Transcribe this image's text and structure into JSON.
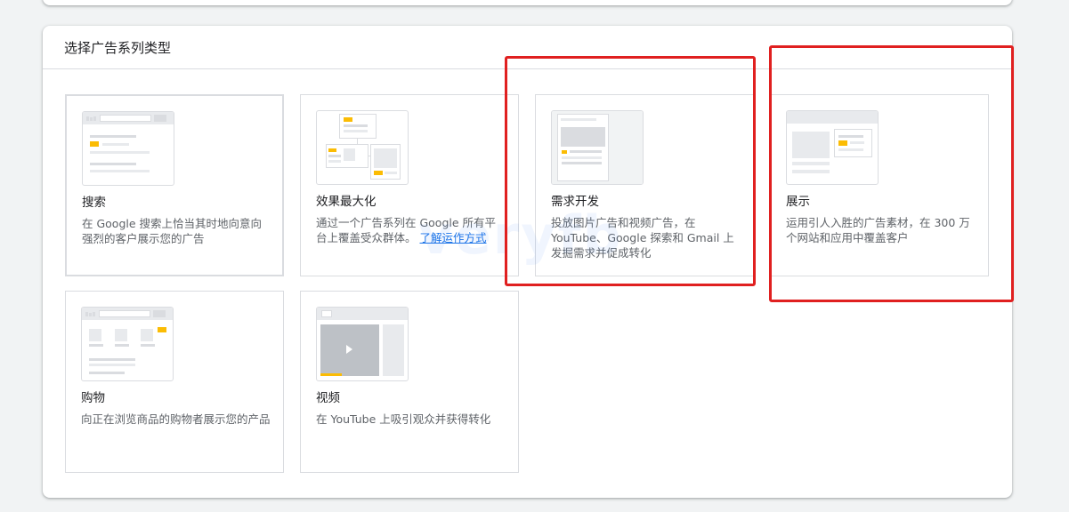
{
  "panel": {
    "title": "选择广告系列类型"
  },
  "cards": [
    {
      "title": "搜索",
      "desc": "在 Google 搜索上恰当其时地向意向强烈的客户展示您的广告"
    },
    {
      "title": "效果最大化",
      "desc": "通过一个广告系列在 Google 所有平台上覆盖受众群体。",
      "link": "了解运作方式"
    },
    {
      "title": "需求开发",
      "desc": "投放图片广告和视频广告，在 YouTube、Google 探索和 Gmail 上发掘需求并促成转化"
    },
    {
      "title": "展示",
      "desc": "运用引人入胜的广告素材，在 300 万个网站和应用中覆盖客户"
    },
    {
      "title": "购物",
      "desc": "向正在浏览商品的购物者展示您的产品"
    },
    {
      "title": "视频",
      "desc": "在 YouTube 上吸引观众并获得转化"
    }
  ],
  "watermark": "veryfb",
  "colors": {
    "highlight": "#e02020",
    "accent_yellow": "#fbbc04",
    "link": "#1a73e8"
  }
}
